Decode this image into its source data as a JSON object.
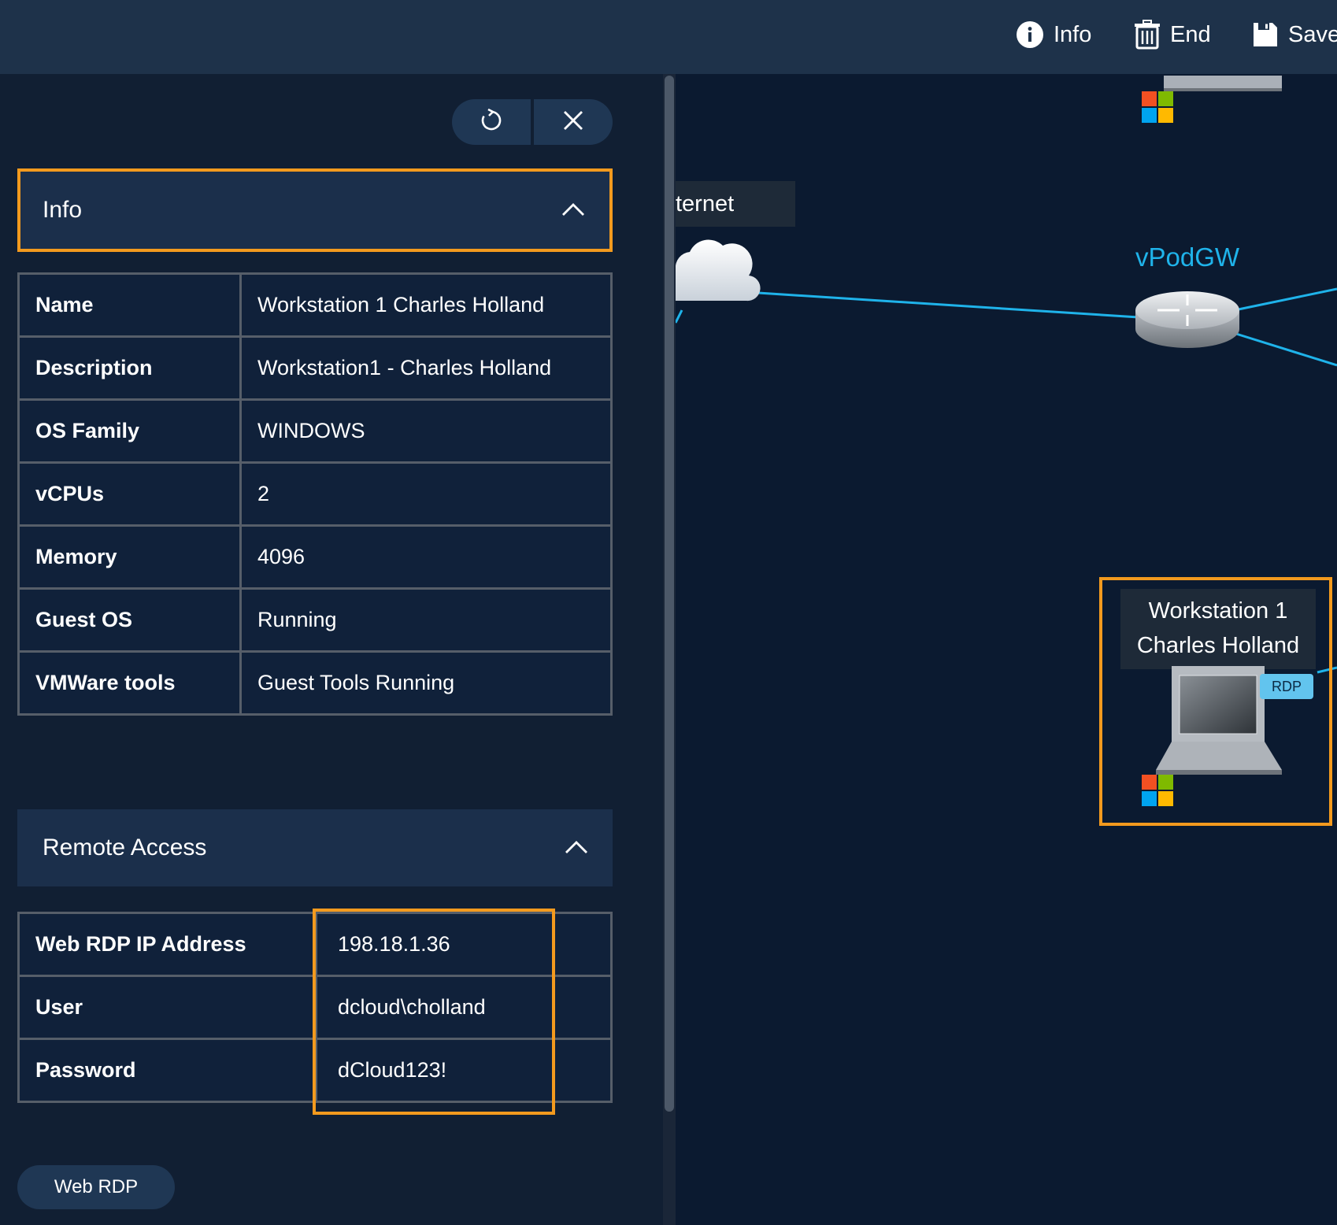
{
  "toolbar": {
    "info_label": "Info",
    "end_label": "End",
    "save_label": "Save"
  },
  "panel": {
    "info_section": {
      "title": "Info",
      "rows": [
        {
          "key": "Name",
          "value": "Workstation 1 Charles Holland"
        },
        {
          "key": "Description",
          "value": "Workstation1 - Charles Holland"
        },
        {
          "key": "OS Family",
          "value": "WINDOWS"
        },
        {
          "key": "vCPUs",
          "value": "2"
        },
        {
          "key": "Memory",
          "value": "4096"
        },
        {
          "key": "Guest OS",
          "value": "Running"
        },
        {
          "key": "VMWare tools",
          "value": "Guest Tools Running"
        }
      ]
    },
    "remote_section": {
      "title": "Remote Access",
      "rows": [
        {
          "key": "Web RDP IP Address",
          "value": "198.18.1.36"
        },
        {
          "key": "User",
          "value": "dcloud\\cholland"
        },
        {
          "key": "Password",
          "value": "dCloud123!"
        }
      ]
    },
    "web_rdp_button": "Web RDP"
  },
  "topology": {
    "internet_label": "ternet",
    "gateway_label": "vPodGW",
    "workstation_label_line1": "Workstation 1",
    "workstation_label_line2": "Charles Holland",
    "rdp_badge": "RDP"
  },
  "colors": {
    "highlight": "#f39a1e",
    "link": "#1fb3ea",
    "panel_bg": "#111f33",
    "header_bg": "#1b2f4b"
  }
}
